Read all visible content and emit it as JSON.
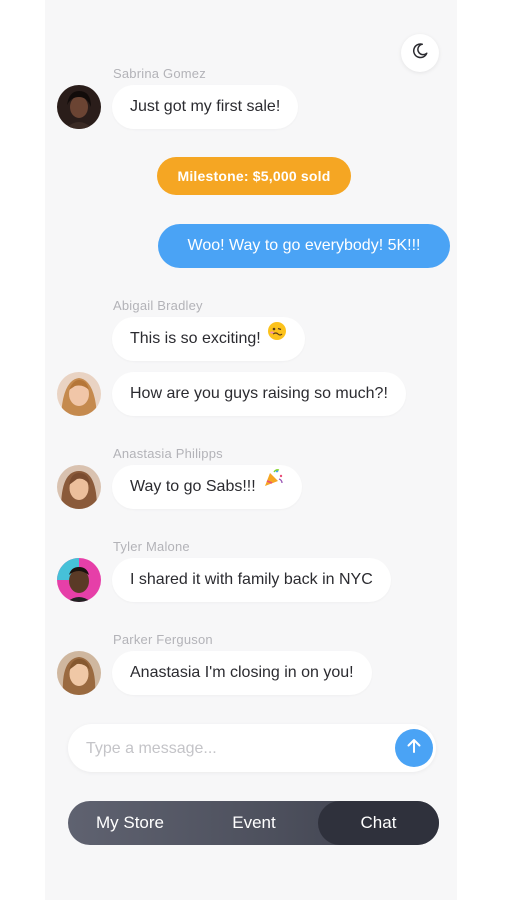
{
  "header": {
    "theme_toggle_icon": "moon-icon"
  },
  "messages": [
    {
      "sender": "Sabrina Gomez",
      "text": "Just got my first sale!"
    },
    {
      "sender": "Abigail Bradley",
      "text": "This is so exciting!",
      "emoji": "woozy-face-icon"
    },
    {
      "text": "How are you guys raising so much?!"
    },
    {
      "sender": "Anastasia Philipps",
      "text": "Way to go Sabs!!!",
      "emoji": "party-popper-icon"
    },
    {
      "sender": "Tyler Malone",
      "text": "I shared it with family back in NYC"
    },
    {
      "sender": "Parker Ferguson",
      "text": "Anastasia I'm closing in on you!"
    }
  ],
  "milestone": {
    "text": "Milestone: $5,000 sold",
    "color": "#f5a623"
  },
  "outgoing": {
    "text": "Woo! Way to go everybody! 5K!!!",
    "color": "#4aa3f5"
  },
  "composer": {
    "placeholder": "Type a message...",
    "value": "",
    "send_icon": "arrow-up-icon"
  },
  "tabs": [
    {
      "label": "My Store",
      "active": false
    },
    {
      "label": "Event",
      "active": false
    },
    {
      "label": "Chat",
      "active": true
    }
  ]
}
